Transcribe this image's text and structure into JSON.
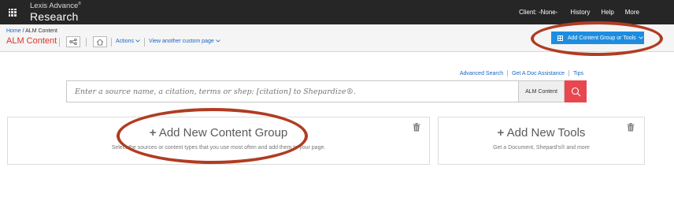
{
  "topbar": {
    "brand_line1": "Lexis Advance",
    "brand_reg": "®",
    "brand_line2": "Research",
    "nav": [
      "Client: -None-",
      "History",
      "Help",
      "More"
    ]
  },
  "subbar": {
    "breadcrumb_home": "Home",
    "breadcrumb_sep": " / ",
    "breadcrumb_current": "ALM Content",
    "page_title": "ALM Content",
    "actions_label": "Actions",
    "custom_page_label": "View another custom page",
    "add_button_label": "Add Content Group or Tools"
  },
  "search": {
    "links": [
      "Advanced Search",
      "Get A Doc Assistance",
      "Tips"
    ],
    "placeholder": "Enter a source name, a citation, terms or shep: [citation] to Shepardize®.",
    "scope": "ALM Content"
  },
  "panels": {
    "content_group": {
      "plus": "+",
      "title": "Add New Content Group",
      "desc": "Select the sources or content types that you use most often and add them to your page."
    },
    "tools": {
      "plus": "+",
      "title": "Add New Tools",
      "desc": "Get a Document, Shepard's® and more"
    }
  },
  "colors": {
    "topbar": "#262626",
    "accent_blue": "#1e8de0",
    "search_red": "#e8474f",
    "annotation_ring": "#b03c22"
  }
}
